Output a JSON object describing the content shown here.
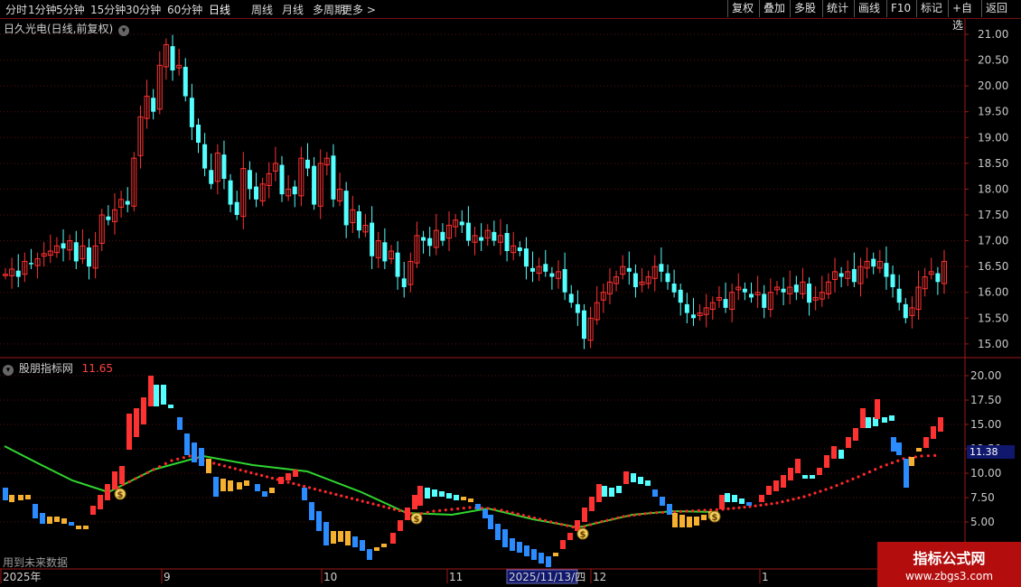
{
  "toolbar": {
    "periods": [
      {
        "label": "分时"
      },
      {
        "label": "1分钟"
      },
      {
        "label": "5分钟"
      },
      {
        "label": "15分钟"
      },
      {
        "label": "30分钟"
      },
      {
        "label": "60分钟"
      },
      {
        "label": "日线",
        "active": true
      },
      {
        "label": "周线"
      },
      {
        "label": "月线"
      },
      {
        "label": "多周期"
      },
      {
        "label": "更多 >"
      }
    ],
    "actions": [
      {
        "label": "复权"
      },
      {
        "label": "叠加"
      },
      {
        "label": "多股"
      },
      {
        "label": "统计"
      },
      {
        "label": "画线"
      },
      {
        "label": "F10"
      },
      {
        "label": "标记"
      },
      {
        "label": "+自选"
      },
      {
        "label": "返回"
      }
    ]
  },
  "price_panel": {
    "title": "日久光电(日线,前复权)"
  },
  "indicator_panel": {
    "title": "股朋指标网",
    "value": "11.65",
    "current_label": "11.38"
  },
  "footer": {
    "future_note": "用到未来数据"
  },
  "watermark": {
    "line1": "指标公式网",
    "line2": "www.zbgs3.com"
  },
  "colors": {
    "up": "#ff3232",
    "down": "#54ffff",
    "grid": "#5a0f0f",
    "axis": "#a01818",
    "ma": "#2fd62f",
    "dots": "#ff2828",
    "blue": "#2a8cff",
    "gold": "#f5b030"
  },
  "chart_data": [
    {
      "type": "candlestick",
      "title": "日久光电(日线,前复权)",
      "y_ticks": [
        "21.00",
        "20.50",
        "20.00",
        "19.50",
        "19.00",
        "18.50",
        "18.00",
        "17.50",
        "17.00",
        "16.50",
        "16.00",
        "15.50",
        "15.00"
      ],
      "ylim": [
        14.8,
        21.2
      ],
      "x_labels": [
        "2025年",
        "9",
        "10",
        "11",
        "2025/11/13/四",
        "12",
        "1"
      ],
      "closes": [
        16.35,
        16.45,
        16.3,
        16.6,
        16.55,
        16.65,
        16.75,
        16.8,
        16.9,
        16.85,
        17.0,
        16.6,
        16.9,
        16.5,
        16.9,
        17.5,
        17.4,
        17.6,
        17.8,
        17.7,
        18.6,
        19.4,
        19.8,
        19.5,
        20.4,
        20.8,
        20.3,
        20.4,
        19.8,
        19.2,
        18.9,
        18.4,
        18.1,
        18.7,
        18.2,
        17.7,
        17.5,
        18.4,
        18.0,
        17.8,
        18.1,
        18.3,
        18.5,
        17.9,
        18.0,
        17.9,
        18.6,
        18.4,
        17.7,
        18.5,
        18.6,
        17.8,
        18.0,
        17.3,
        17.6,
        17.2,
        17.3,
        16.7,
        17.0,
        16.6,
        16.8,
        16.3,
        16.1,
        16.6,
        17.1,
        17.0,
        16.9,
        17.2,
        17.0,
        17.3,
        17.4,
        17.3,
        17.0,
        17.1,
        17.0,
        17.2,
        17.0,
        17.1,
        16.8,
        16.9,
        16.8,
        16.5,
        16.4,
        16.5,
        16.4,
        16.3,
        16.4,
        16.0,
        15.8,
        15.6,
        15.1,
        15.5,
        15.8,
        16.0,
        16.2,
        16.3,
        16.5,
        16.4,
        16.1,
        16.2,
        16.3,
        16.5,
        16.4,
        16.2,
        16.0,
        15.8,
        15.6,
        15.5,
        15.6,
        15.7,
        15.8,
        15.9,
        15.7,
        16.0,
        16.1,
        16.0,
        15.9,
        16.0,
        15.7,
        16.0,
        16.1,
        16.0,
        16.1,
        16.0,
        16.2,
        15.8,
        15.9,
        16.0,
        16.2,
        16.4,
        16.3,
        16.4,
        16.2,
        16.5,
        16.6,
        16.5,
        16.6,
        16.3,
        16.1,
        15.8,
        15.5,
        15.7,
        16.1,
        16.3,
        16.4,
        16.2,
        16.6
      ]
    },
    {
      "type": "indicator",
      "title": "股朋指标网",
      "y_ticks": [
        "20.00",
        "17.50",
        "15.00",
        "12.50",
        "10.00",
        "7.50",
        "5.00"
      ],
      "ylim": [
        3.0,
        21.0
      ],
      "last_value": 11.65,
      "current_marker": 11.38
    }
  ]
}
